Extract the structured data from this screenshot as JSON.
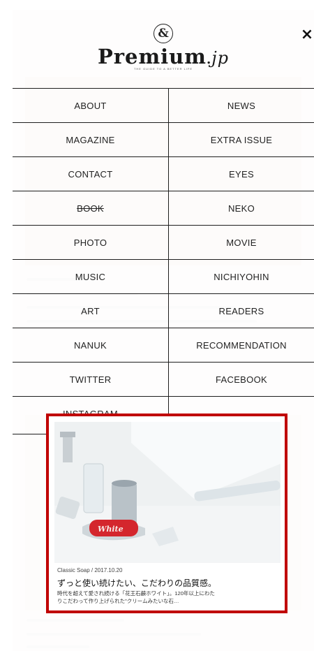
{
  "logo": {
    "ampersand": "&",
    "name": "Premium",
    "dot": ".",
    "suffix": "jp",
    "tagline": "THE GUIDE TO A BETTER LIFE"
  },
  "close_label": "×",
  "menu": [
    [
      "ABOUT",
      "NEWS"
    ],
    [
      "MAGAZINE",
      "EXTRA ISSUE"
    ],
    [
      "CONTACT",
      "EYES"
    ],
    [
      "BOOK",
      "NEKO"
    ],
    [
      "PHOTO",
      "MOVIE"
    ],
    [
      "MUSIC",
      "NICHIYOHIN"
    ],
    [
      "ART",
      "READERS"
    ],
    [
      "NANUK",
      "RECOMMENDATION"
    ],
    [
      "TWITTER",
      "FACEBOOK"
    ],
    [
      "INSTAGRAM",
      ""
    ]
  ],
  "card": {
    "meta": "Classic Soap / 2017.10.20",
    "title": "ずっと使い続けたい、こだわりの品質感。",
    "desc_line1": "時代を超えて愛され続ける「花王石鹸ホワイト」。120年以上にわた",
    "desc_line2": "りこだわって作り上げられた\"クリームみたいな石…"
  },
  "colors": {
    "highlight": "#c00000",
    "grid_lines": "#1e1e1e"
  }
}
